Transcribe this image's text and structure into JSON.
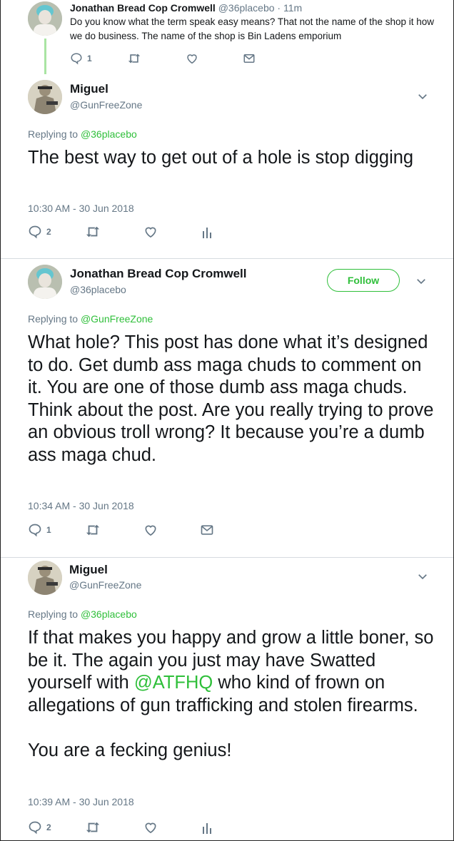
{
  "tweets": [
    {
      "name": "Jonathan Bread Cop Cromwell",
      "handle": "@36placebo",
      "time_ago": "· 11m",
      "text": "Do you know what the term speak easy means? That not the name of the shop it how we do business. The name of the shop is Bin Ladens emporium",
      "reply_count": "1"
    },
    {
      "name": "Miguel",
      "handle": "@GunFreeZone",
      "replying_label": "Replying to",
      "replying_to": "@36placebo",
      "text": "The best way to get out of a hole is stop digging",
      "timestamp": "10:30 AM - 30 Jun 2018",
      "reply_count": "2"
    },
    {
      "name": "Jonathan Bread Cop Cromwell",
      "handle": "@36placebo",
      "follow_label": "Follow",
      "replying_label": "Replying to",
      "replying_to": "@GunFreeZone",
      "text": "What hole? This post has done what it’s designed to do. Get dumb ass maga chuds to comment on it. You are one of those dumb ass maga chuds. Think about the post. Are you really trying to prove an obvious troll wrong? It because you’re a dumb ass maga chud.",
      "timestamp": "10:34 AM - 30 Jun 2018",
      "reply_count": "1"
    },
    {
      "name": "Miguel",
      "handle": "@GunFreeZone",
      "replying_label": "Replying to",
      "replying_to": "@36placebo",
      "text_part1": "If that makes you happy and grow a little boner, so be it. The again you just may have Swatted yourself with",
      "mention": "@ATFHQ",
      "text_part2": " who kind of frown on allegations of gun trafficking and stolen firearms.",
      "text_part3": "You are a fecking genius!",
      "timestamp": "10:39 AM - 30 Jun 2018",
      "reply_count": "2"
    }
  ],
  "colors": {
    "accent_green": "#2fbf3a",
    "thread_line": "#a9e4a3",
    "icon_gray": "#657786"
  }
}
